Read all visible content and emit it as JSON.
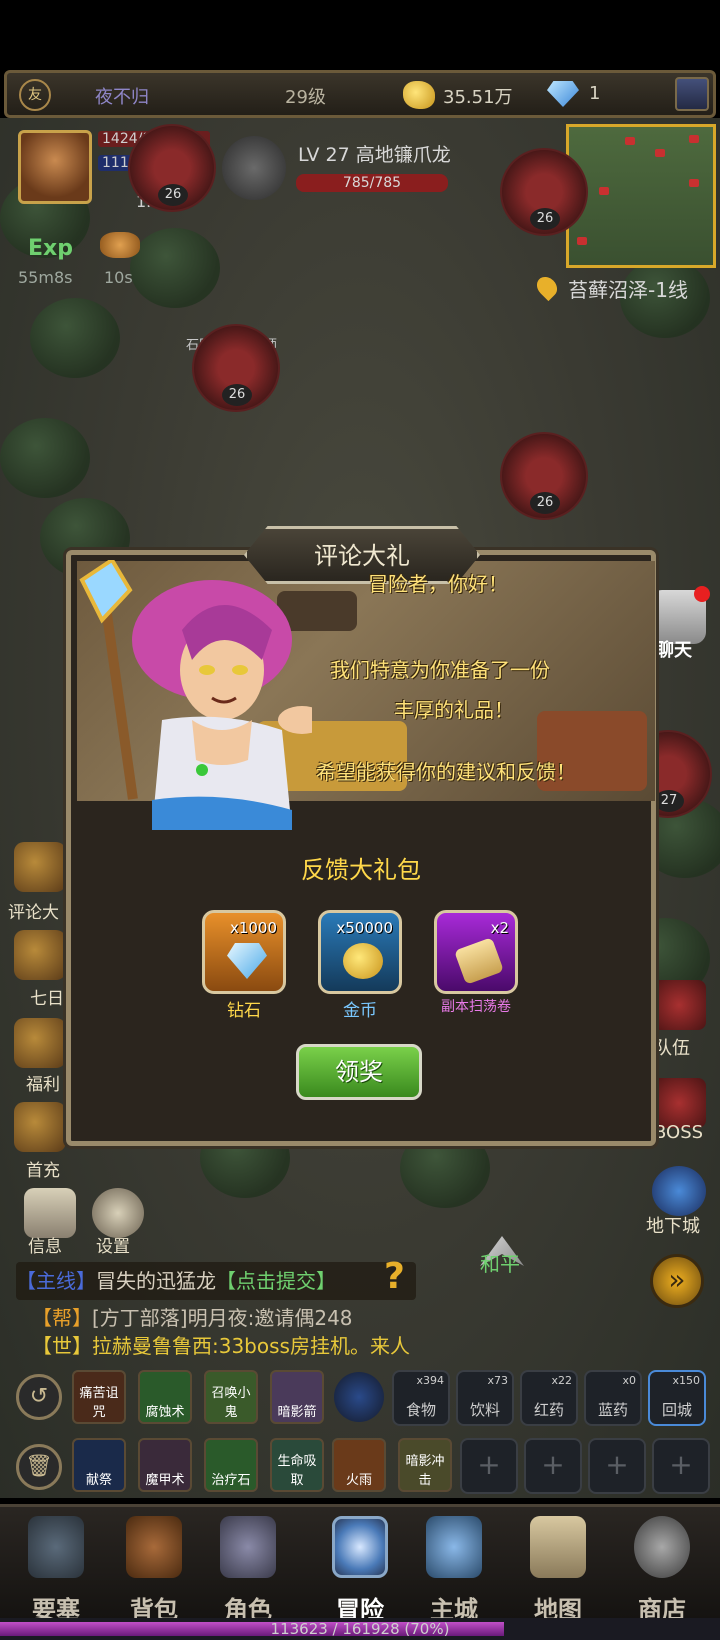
{
  "topbar": {
    "logo_text": "友",
    "player_name": "夜不归",
    "level": "29级",
    "gold": "35.51万",
    "diamonds": "1"
  },
  "player": {
    "hp": "1424/1535",
    "mp": "1114/1578",
    "power": "1.17万",
    "exp_label": "Exp",
    "exp_timer": "55m8s",
    "food_timer": "10s"
  },
  "monster": {
    "name": "LV 27 高地镰爪龙",
    "hp": "785/785"
  },
  "minimap": {
    "location": "苔藓沼泽-1线"
  },
  "npc": {
    "name": "石匠工会附魔师"
  },
  "enemies": [
    {
      "level": "26"
    },
    {
      "level": "26"
    },
    {
      "level": "26"
    },
    {
      "level": "26"
    },
    {
      "level": "27"
    }
  ],
  "chat_button": {
    "label": "聊天"
  },
  "left_menu": [
    {
      "label": "评论大"
    },
    {
      "label": "七日"
    },
    {
      "label": "福利"
    },
    {
      "label": "首充"
    },
    {
      "label": "信息"
    },
    {
      "label": "设置"
    }
  ],
  "right_menu": [
    {
      "label": "队伍"
    },
    {
      "label": "BOSS"
    },
    {
      "label": "地下城"
    }
  ],
  "dialog": {
    "title": "评论大礼",
    "greeting": "冒险者，你好！",
    "line1": "我们特意为你准备了一份",
    "line2": "丰厚的礼品！",
    "line3": "希望能获得你的建议和反馈！",
    "pack_title": "反馈大礼包",
    "rewards": [
      {
        "name": "钻石",
        "count": "x1000",
        "color": "#c8701a"
      },
      {
        "name": "金币",
        "count": "x50000",
        "color": "#1e5a8a"
      },
      {
        "name": "副本扫荡卷",
        "count": "x2",
        "color": "#8a1ea8"
      }
    ],
    "claim_label": "领奖"
  },
  "quest": {
    "tag": "【主线】",
    "text": "冒失的迅猛龙",
    "action": "【点击提交】"
  },
  "chat": {
    "line1_channel": "【帮】",
    "line1_text": "[方丁部落]明月夜:邀请偶248",
    "line2_channel": "【世】",
    "line2_text": "拉赫曼鲁鲁西:33boss房挂机。来人"
  },
  "peace_label": "和平",
  "skills_row1": [
    {
      "label": "痛苦诅咒"
    },
    {
      "label": "腐蚀术"
    },
    {
      "label": "召唤小鬼"
    },
    {
      "label": "暗影箭"
    }
  ],
  "items": [
    {
      "label": "食物",
      "count": "x394"
    },
    {
      "label": "饮料",
      "count": "x73"
    },
    {
      "label": "红药",
      "count": "x22"
    },
    {
      "label": "蓝药",
      "count": "x0"
    },
    {
      "label": "回城",
      "count": "x150"
    }
  ],
  "skills_row2": [
    {
      "label": "献祭"
    },
    {
      "label": "魔甲术"
    },
    {
      "label": "治疗石"
    },
    {
      "label": "生命吸取"
    },
    {
      "label": "火雨"
    },
    {
      "label": "暗影冲击"
    }
  ],
  "nav": [
    {
      "label": "要塞"
    },
    {
      "label": "背包"
    },
    {
      "label": "角色"
    },
    {
      "label": "冒险"
    },
    {
      "label": "主城"
    },
    {
      "label": "地图"
    },
    {
      "label": "商店"
    }
  ],
  "xp": {
    "text": "113623 / 161928 (70%)",
    "fraction": 0.7
  },
  "colors": {
    "accent_gold": "#ffd84a",
    "message_yellow": "#ffe27a",
    "claim_green": "#5ab030",
    "quest_blue": "#4a6ad8",
    "quest_green": "#6fd06f"
  }
}
